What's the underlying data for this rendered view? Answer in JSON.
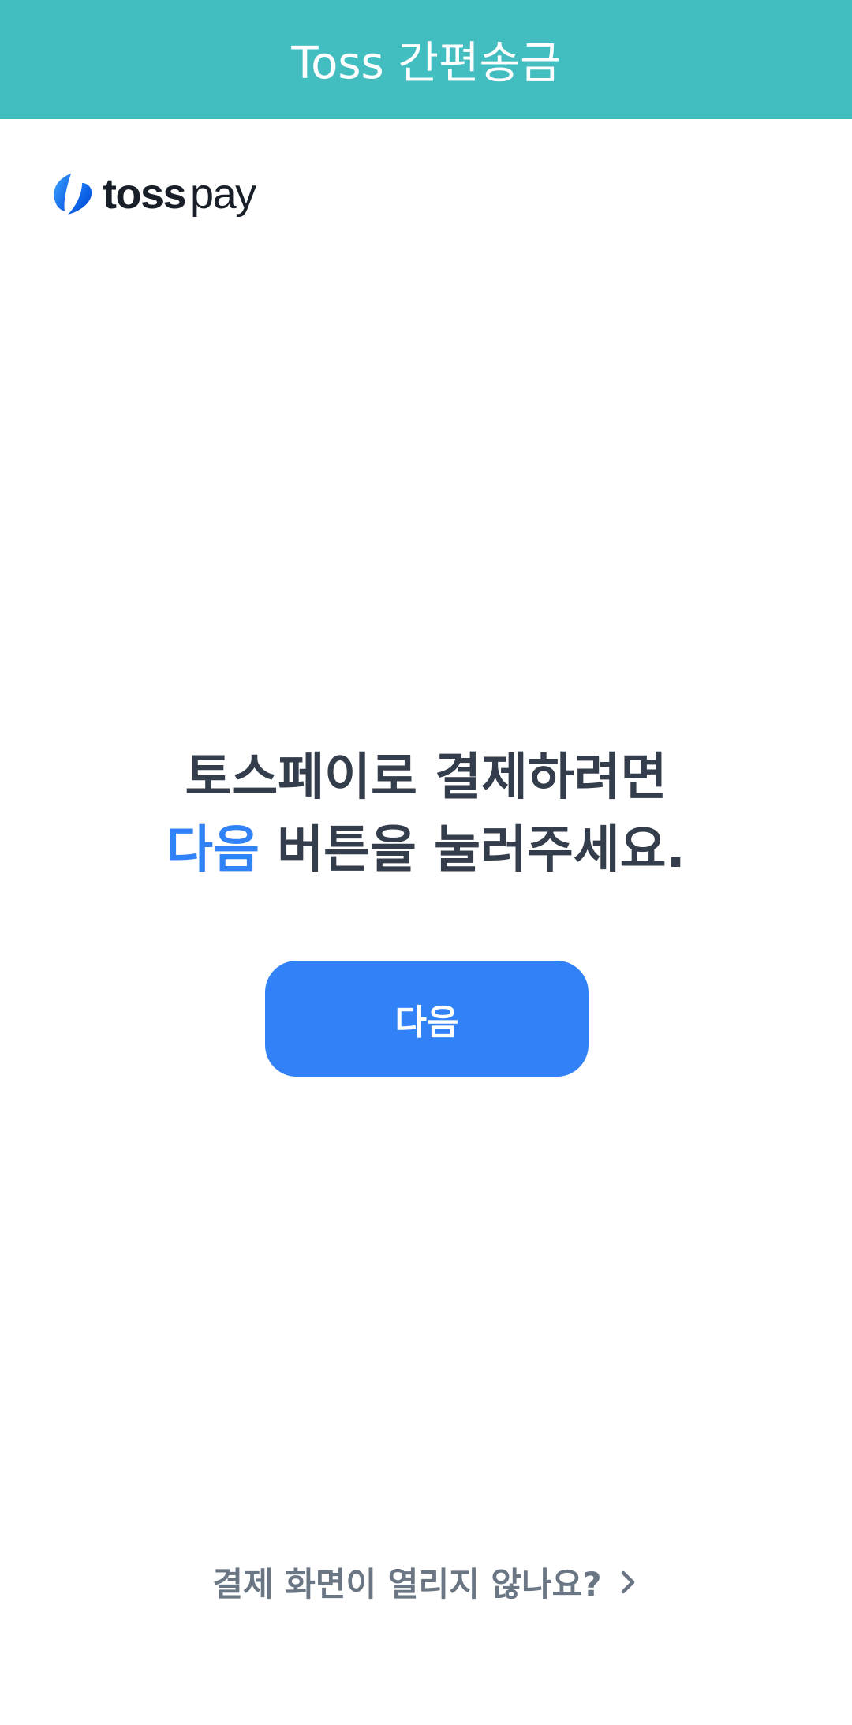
{
  "app_bar": {
    "title": "Toss 간편송금",
    "color": "#42bec1"
  },
  "logo": {
    "icon": "tosspay-logo-icon",
    "brand_bold": "toss",
    "brand_regular": "pay"
  },
  "headline": {
    "line1": "토스페이로 결제하려면",
    "accent": "다음",
    "line2_rest": " 버튼을 눌러주세요.",
    "accent_color": "#3182f6"
  },
  "next_button": {
    "label": "다음",
    "color": "#3182f6"
  },
  "help_link": {
    "label": "결제 화면이 열리지 않나요?",
    "icon": "chevron-right-icon"
  }
}
